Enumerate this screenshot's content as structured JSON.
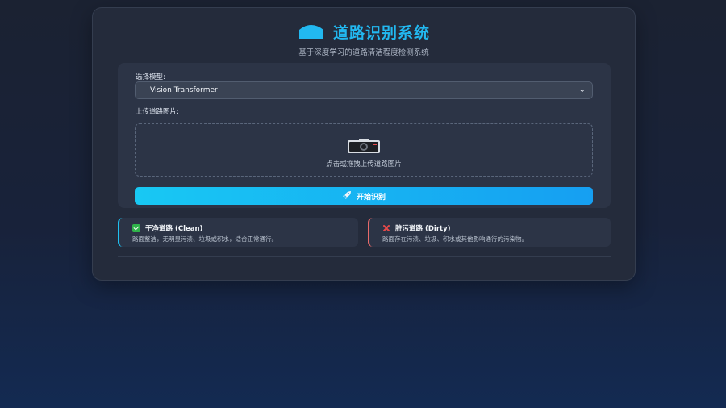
{
  "header": {
    "title": "道路识别系统",
    "subtitle": "基于深度学习的道路清洁程度检测系统"
  },
  "form": {
    "model_label": "选择模型:",
    "model_selected": "Vision Transformer",
    "upload_label": "上传道路图片:",
    "upload_hint": "点击或拖拽上传道路图片",
    "start_button": "开始识别"
  },
  "categories": [
    {
      "title": "干净道路 (Clean)",
      "description": "路面整洁，无明显污渍、垃圾或积水，适合正常通行。",
      "icon": "check-icon",
      "color": "#1fc0f0"
    },
    {
      "title": "脏污道路 (Dirty)",
      "description": "路面存在污渍、垃圾、积水或其他影响通行的污染物。",
      "icon": "cross-icon",
      "color": "#e86a6a"
    }
  ],
  "colors": {
    "accent": "#22b8f0",
    "button_start": "#18c8f3",
    "button_end": "#169ff2"
  }
}
